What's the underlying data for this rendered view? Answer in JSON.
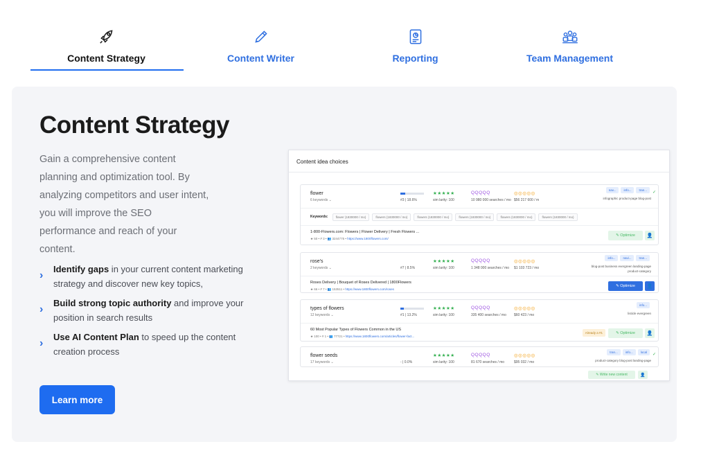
{
  "tabs": [
    {
      "label": "Content Strategy",
      "icon": "rocket-icon",
      "active": true
    },
    {
      "label": "Content Writer",
      "icon": "pen-icon",
      "active": false
    },
    {
      "label": "Reporting",
      "icon": "report-icon",
      "active": false
    },
    {
      "label": "Team Management",
      "icon": "team-icon",
      "active": false
    }
  ],
  "panel": {
    "title": "Content Strategy",
    "description": "Gain a comprehensive content planning and optimization tool. By analyzing competitors and user intent, you will improve the SEO performance and reach of your content.",
    "bullets": [
      {
        "bold": "Identify gaps",
        "text": " in your current content marketing strategy and discover new key topics,"
      },
      {
        "bold": "Build strong topic authority",
        "text": " and improve your position in search results"
      },
      {
        "bold": "Use AI Content Plan",
        "text": " to speed up the content creation process"
      }
    ],
    "button_label": "Learn more"
  },
  "preview": {
    "header": "Content idea choices",
    "keywords_label": "Keywords:",
    "optimize_label": "Optimize",
    "already_label": "Already a #1",
    "write_label": "Write new content",
    "stars": "★★★★★",
    "hollow": "QQQQQ",
    "coins": "◎◎◎◎◎",
    "rows": [
      {
        "name": "flower",
        "count": "6 keywords  ⌄",
        "rank": "#3  |  18.6%",
        "similarity": "sim larity: 100",
        "searches": "10 980 000 searches / mo",
        "value": "$56 217 600 / m",
        "tags": [
          "nav...",
          "info...",
          "tran..."
        ],
        "intent": "infographic  product-page  blog-post",
        "keywords": [
          "flower (1830000 / mo)",
          "flowers (1830000 / mo)",
          "flowers (1830000 / mo)",
          "flowers (1830000 / mo)",
          "flowers (1830000 / mo)",
          "flowers (1830000 / mo)"
        ],
        "page_title": "1-800-Flowers.com: Flowers | Flower Delivery | Fresh Flowers ...",
        "page_meta": "★ 50  •  # 3  •  👥 3244775  •",
        "page_url": "https://www.1800flowers.com/"
      },
      {
        "name": "rose's",
        "count": "2 keywords  ⌄",
        "rank": "#7  |  8.5%",
        "similarity": "sim larity: 100",
        "searches": "1 348 000 searches / mo",
        "value": "$1 103 723 / mo",
        "tags": [
          "info...",
          "navi...",
          "tran..."
        ],
        "intent": "blog-post  business  evergreen  landing-page  product-category",
        "page_title": "Roses Delivery | Bouquet of Roses Delivered | 1800Flowers",
        "page_meta": "★ 66  •  # 7  •  👥 153511  •",
        "page_url": "https://www.1800flowers.com/roses"
      },
      {
        "name": "types of flowers",
        "count": "12 keywords  ⌄",
        "rank": "#1  |  13.2%",
        "similarity": "sim larity: 100",
        "searches": "335 400 searches / mo",
        "value": "$60 423 / mo",
        "tags": [
          "info..."
        ],
        "intent": "listicle  evergreen",
        "page_title": "60 Most Popular Types of Flowers Common in the US",
        "page_meta": "★ 100  •  # 1  •  👥 77721  •",
        "page_url": "https://www.1800flowers.com/articles/flower-fact..."
      },
      {
        "name": "flower seeds",
        "count": "17 keywords  ⌄",
        "rank": "-  |  0.0%",
        "similarity": "sim larity: 100",
        "searches": "81 670 searches / mo",
        "value": "$95 032 / mo",
        "tags": [
          "tran...",
          "info...",
          "local"
        ],
        "intent": "product-category  blog-post  landing-page"
      }
    ]
  },
  "colors": {
    "accent": "#1e6cf0",
    "panel_bg": "#f4f5f8",
    "green": "#2fae4c",
    "purple": "#9a4fe0",
    "orange": "#f3a21c"
  }
}
